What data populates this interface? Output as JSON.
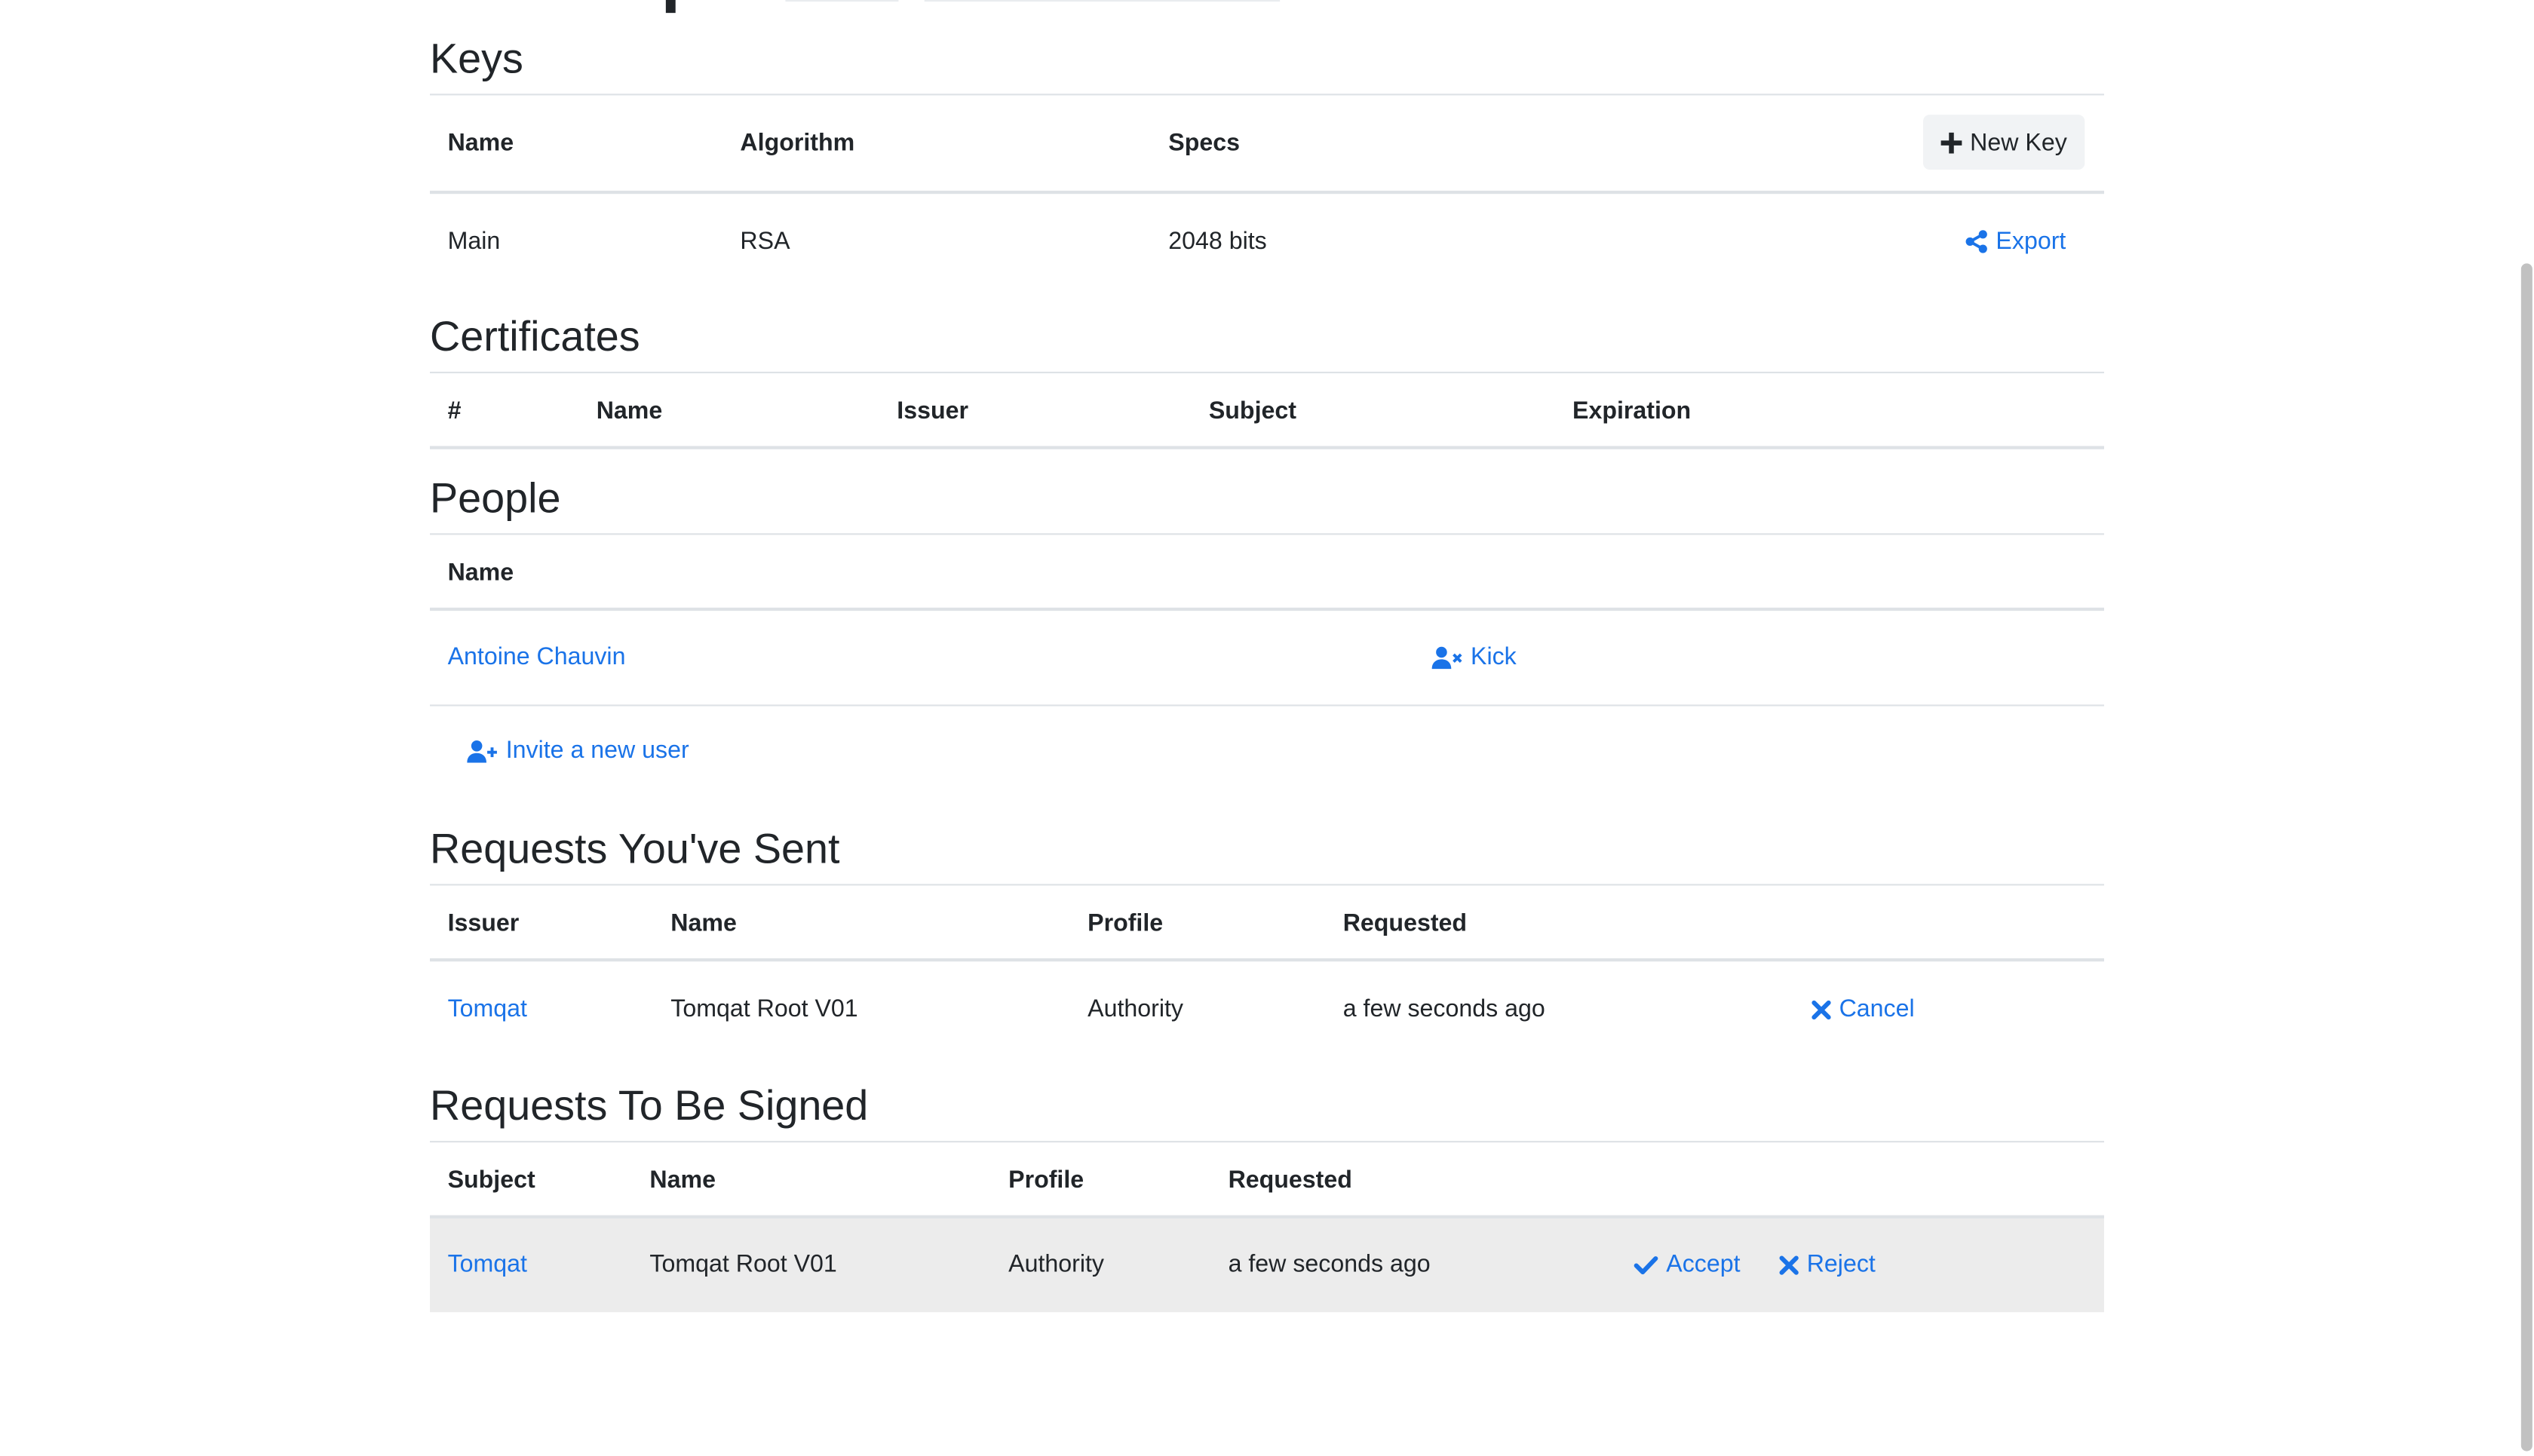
{
  "keys": {
    "title": "Keys",
    "columns": [
      "Name",
      "Algorithm",
      "Specs"
    ],
    "new_key_label": "New Key",
    "rows": [
      {
        "name": "Main",
        "algorithm": "RSA",
        "specs": "2048 bits",
        "action": "Export"
      }
    ]
  },
  "certificates": {
    "title": "Certificates",
    "columns": [
      "#",
      "Name",
      "Issuer",
      "Subject",
      "Expiration"
    ]
  },
  "people": {
    "title": "People",
    "columns": [
      "Name"
    ],
    "rows": [
      {
        "name": "Antoine Chauvin",
        "action": "Kick"
      }
    ],
    "invite_label": "Invite a new user"
  },
  "requests_sent": {
    "title": "Requests You've Sent",
    "columns": [
      "Issuer",
      "Name",
      "Profile",
      "Requested"
    ],
    "rows": [
      {
        "issuer": "Tomqat",
        "name": "Tomqat Root V01",
        "profile": "Authority",
        "requested": "a few seconds ago",
        "action": "Cancel"
      }
    ]
  },
  "requests_to_sign": {
    "title": "Requests To Be Signed",
    "columns": [
      "Subject",
      "Name",
      "Profile",
      "Requested"
    ],
    "rows": [
      {
        "subject": "Tomqat",
        "name": "Tomqat Root V01",
        "profile": "Authority",
        "requested": "a few seconds ago",
        "accept": "Accept",
        "reject": "Reject"
      }
    ]
  },
  "colors": {
    "link": "#1a73e8",
    "text": "#212529",
    "border": "#dee2e6",
    "row_highlight": "#ececec"
  },
  "icons": [
    "plus-icon",
    "share-icon",
    "user-times-icon",
    "user-plus-icon",
    "times-icon",
    "check-icon"
  ]
}
